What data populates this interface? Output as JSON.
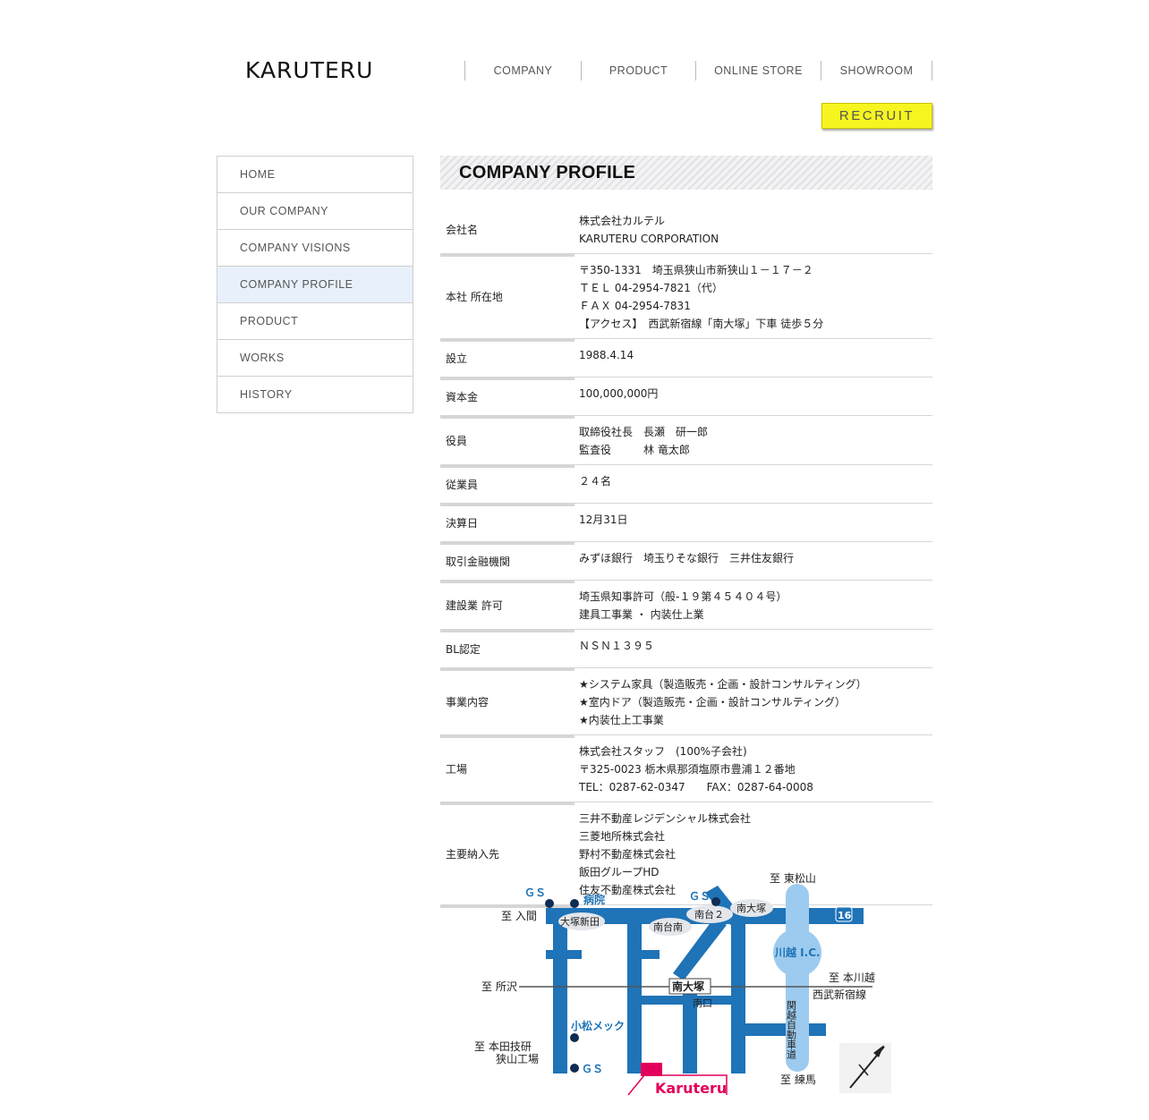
{
  "header": {
    "logo": "KARUTERU",
    "nav": [
      "COMPANY",
      "PRODUCT",
      "ONLINE STORE",
      "SHOWROOM"
    ],
    "recruit_label": "RECRUIT"
  },
  "sidebar": {
    "items": [
      {
        "label": "HOME",
        "active": false
      },
      {
        "label": "OUR COMPANY",
        "active": false
      },
      {
        "label": "COMPANY VISIONS",
        "active": false
      },
      {
        "label": "COMPANY PROFILE",
        "active": true
      },
      {
        "label": "PRODUCT",
        "active": false
      },
      {
        "label": "WORKS",
        "active": false
      },
      {
        "label": "HISTORY",
        "active": false
      }
    ]
  },
  "main": {
    "title": "COMPANY PROFILE",
    "profile_rows": [
      {
        "label": "会社名",
        "lines": [
          "株式会社カルテル",
          "KARUTERU CORPORATION"
        ]
      },
      {
        "label": "本社 所在地",
        "lines": [
          "〒350-1331　埼玉県狭山市新狭山１－１７－２",
          "ＴＥＬ 04-2954-7821（代）",
          "ＦＡＸ 04-2954-7831",
          "【アクセス】　西武新宿線「南大塚」下車 徒歩５分"
        ]
      },
      {
        "label": "設立",
        "lines": [
          "1988.4.14"
        ]
      },
      {
        "label": "資本金",
        "lines": [
          "100,000,000円"
        ]
      },
      {
        "label": "役員",
        "lines": [
          "取締役社長　長瀬　研一郎",
          "監査役　　　林 竜太郎"
        ]
      },
      {
        "label": "従業員",
        "lines": [
          "２４名"
        ]
      },
      {
        "label": "決算日",
        "lines": [
          "12月31日"
        ]
      },
      {
        "label": "取引金融機関",
        "lines": [
          "みずほ銀行　埼玉りそな銀行　三井住友銀行"
        ]
      },
      {
        "label": "建設業 許可",
        "lines": [
          "埼玉県知事許可（般-１９第４５４０４号）",
          "建具工事業 ・ 内装仕上業"
        ]
      },
      {
        "label": "BL認定",
        "lines": [
          "ＮＳＮ１３９５"
        ]
      },
      {
        "label": "事業内容",
        "lines": [
          "★システム家具（製造販売・企画・設計コンサルティング）",
          "★室内ドア（製造販売・企画・設計コンサルティング）",
          "★内装仕上工事業"
        ]
      },
      {
        "label": "工場",
        "lines": [
          "株式会社スタッフ　(100%子会社)",
          "〒325-0023 栃木県那須塩原市豊浦１２番地",
          "TEL：0287-62-0347　　FAX：0287-64-0008"
        ]
      },
      {
        "label": "主要納入先",
        "lines": [
          "三井不動産レジデンシャル株式会社",
          "三菱地所株式会社",
          "野村不動産株式会社",
          "飯田グループHD",
          "住友不動産株式会社"
        ]
      }
    ]
  },
  "map": {
    "labels": {
      "gs": "ＧＳ",
      "hospital": "病院",
      "to_iruma": "至 入間",
      "otsuka_shinden": "大塚新田",
      "minamidainan": "南台南",
      "minamidai2": "南台２",
      "minamiotsuka_area": "南大塚",
      "to_higashimatsuyama": "至 東松山",
      "route16": "16",
      "kawagoe_ic": "川越 I.C.",
      "to_tokorozawa": "至 所沢",
      "minamiotsuka_station": "南大塚",
      "south_exit": "南口",
      "to_honkawagoe": "至 本川越",
      "seibu_line": "西武新宿線",
      "komatsu": "小松メック",
      "kanetsu": "関越自動車道",
      "to_honda": "至 本田技研",
      "sayama_factory": "狭山工場",
      "karuteru": "Karuteru",
      "to_nerima": "至 練馬"
    },
    "colors": {
      "road": "#1f73b7",
      "expressway": "#9ccbef",
      "marker": "#e2005a",
      "label_bubble": "#e3e6ea"
    }
  }
}
